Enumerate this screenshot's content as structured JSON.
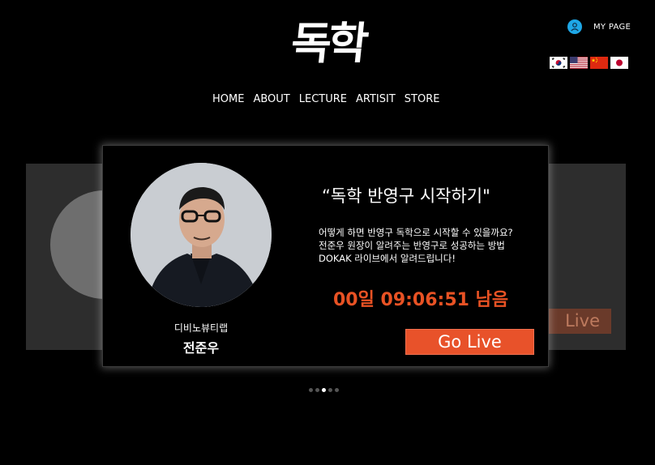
{
  "header": {
    "logo": "독학",
    "my_page": "MY PAGE",
    "flags": [
      "korea-flag",
      "usa-flag",
      "china-flag",
      "japan-flag"
    ]
  },
  "nav": {
    "items": [
      "HOME",
      "ABOUT",
      "LECTURE",
      "ARTISIT",
      "STORE"
    ]
  },
  "card": {
    "org": "디비노뷰티랩",
    "name": "전준우",
    "headline": "“독학 반영구 시작하기\"",
    "description": [
      "어떻게 하면 반영구 독학으로 시작할 수 있을까요?",
      "전준우 원장이 알려주는 반영구로 성공하는 방법",
      "DOKAK 라이브에서 알려드립니다!"
    ],
    "countdown": "00일 09:06:51 남음",
    "go_live": "Go Live"
  },
  "background_card": {
    "button_text": "Live"
  },
  "carousel": {
    "count": 5,
    "active": 2
  },
  "colors": {
    "accent": "#e8522a",
    "countdown": "#e85224",
    "user_icon": "#1ea7e6"
  }
}
